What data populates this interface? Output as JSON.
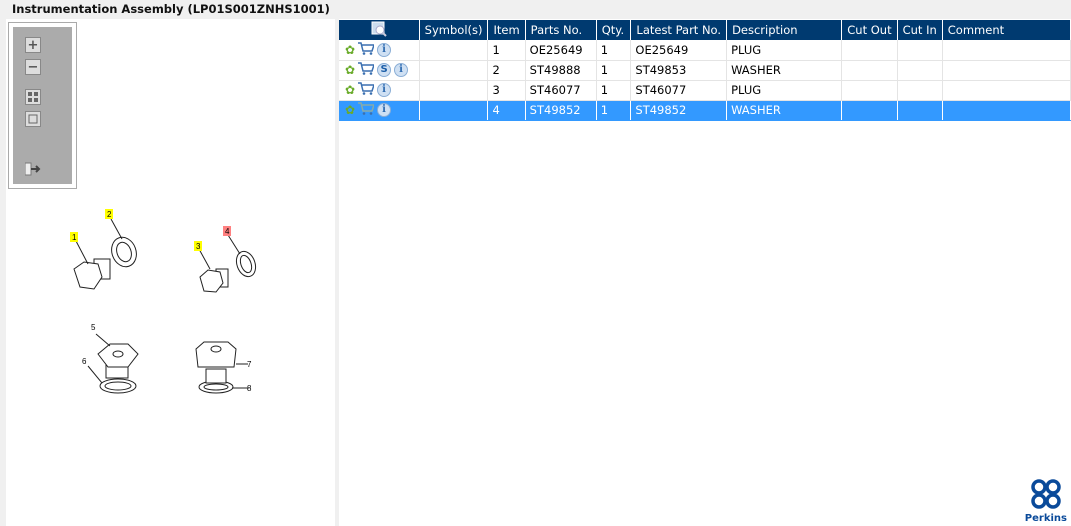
{
  "title": "Instrumentation Assembly (LP01S001ZNHS1001)",
  "toolbar": {
    "zoom_in": "+",
    "zoom_out": "−"
  },
  "table": {
    "headers": [
      "Symbol(s)",
      "Item",
      "Parts No.",
      "Qty.",
      "Latest Part No.",
      "Description",
      "Cut Out",
      "Cut In",
      "Comment"
    ],
    "rows": [
      {
        "item": "1",
        "part": "OE25649",
        "qty": "1",
        "latest": "OE25649",
        "desc": "PLUG",
        "supersede": false,
        "selected": false
      },
      {
        "item": "2",
        "part": "ST49888",
        "qty": "1",
        "latest": "ST49853",
        "desc": "WASHER",
        "supersede": true,
        "selected": false
      },
      {
        "item": "3",
        "part": "ST46077",
        "qty": "1",
        "latest": "ST46077",
        "desc": "PLUG",
        "supersede": false,
        "selected": false
      },
      {
        "item": "4",
        "part": "ST49852",
        "qty": "1",
        "latest": "ST49852",
        "desc": "WASHER",
        "supersede": false,
        "selected": true
      }
    ]
  },
  "icons": {
    "info": "i",
    "supersede": "S"
  },
  "diagram": {
    "callouts": [
      "1",
      "2",
      "3",
      "4",
      "5",
      "6",
      "7",
      "8"
    ]
  },
  "logo": "Perkins",
  "colors": {
    "header": "#003a70",
    "selected": "#3399ff",
    "highlight": "#ffff00",
    "highlight_selected": "#ff8080"
  }
}
